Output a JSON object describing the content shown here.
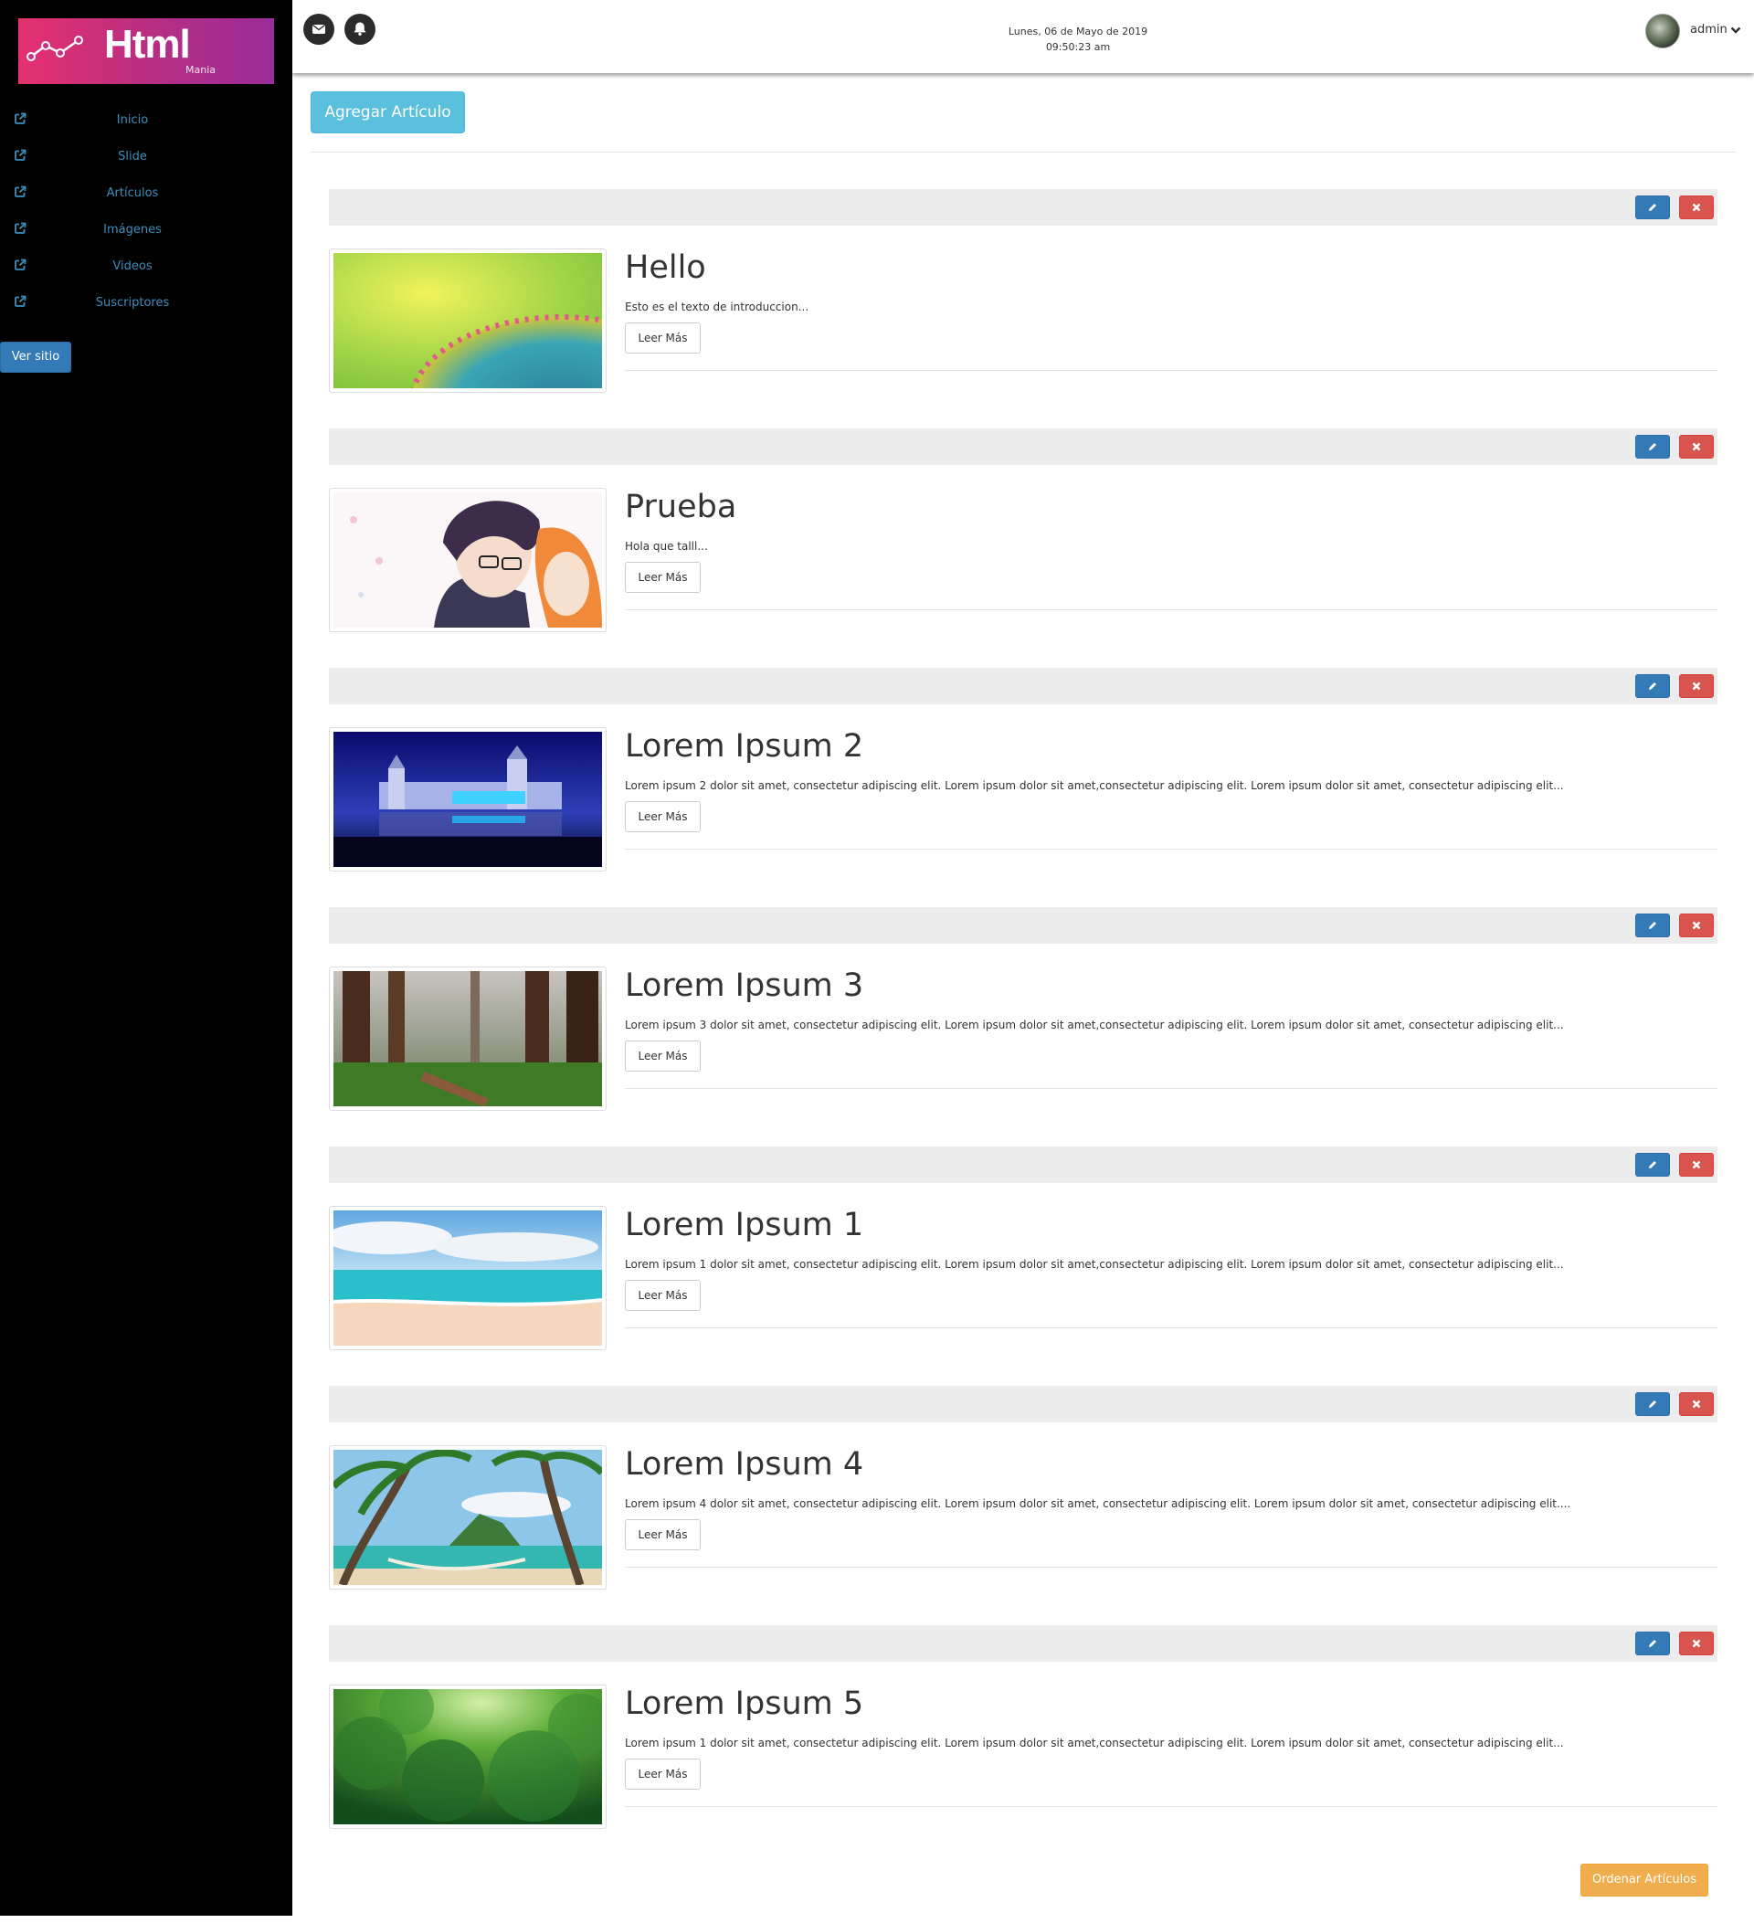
{
  "brand": {
    "name": "Html",
    "subtitle": "Mania"
  },
  "sidebar": {
    "items": [
      {
        "label": "Inicio",
        "icon": "external-link-icon"
      },
      {
        "label": "Slide",
        "icon": "external-link-icon"
      },
      {
        "label": "Artículos",
        "icon": "external-link-icon"
      },
      {
        "label": "Imágenes",
        "icon": "external-link-icon"
      },
      {
        "label": "Videos",
        "icon": "external-link-icon"
      },
      {
        "label": "Suscriptores",
        "icon": "external-link-icon"
      }
    ],
    "ver_sitio": "Ver sitio"
  },
  "header": {
    "date": "Lunes, 06 de Mayo de 2019",
    "time": "09:50:23 am",
    "user": "admin",
    "icons": [
      "envelope-icon",
      "bell-icon",
      "chevron-down-icon"
    ]
  },
  "main": {
    "add_button": "Agregar Artículo",
    "read_more": "Leer Más",
    "order_button": "Ordenar Artículos",
    "articles": [
      {
        "title": "Hello",
        "intro": "Esto es el texto de introduccion...",
        "image": "chameleon-closeup"
      },
      {
        "title": "Prueba",
        "intro": "Hola que talll...",
        "image": "anime-couple"
      },
      {
        "title": "Lorem Ipsum 2",
        "intro": "Lorem ipsum 2 dolor sit amet, consectetur adipiscing elit. Lorem ipsum dolor sit amet,consectetur adipiscing elit. Lorem ipsum dolor sit amet, consectetur adipiscing elit...",
        "image": "castle-night"
      },
      {
        "title": "Lorem Ipsum 3",
        "intro": "Lorem ipsum 3 dolor sit amet, consectetur adipiscing elit. Lorem ipsum dolor sit amet,consectetur adipiscing elit. Lorem ipsum dolor sit amet, consectetur adipiscing elit...",
        "image": "redwood-forest"
      },
      {
        "title": "Lorem Ipsum 1",
        "intro": "Lorem ipsum 1 dolor sit amet, consectetur adipiscing elit. Lorem ipsum dolor sit amet,consectetur adipiscing elit. Lorem ipsum dolor sit amet, consectetur adipiscing elit...",
        "image": "tropical-beach"
      },
      {
        "title": "Lorem Ipsum 4",
        "intro": "Lorem ipsum 4 dolor sit amet, consectetur adipiscing elit. Lorem ipsum dolor sit amet, consectetur adipiscing elit. Lorem ipsum dolor sit amet, consectetur adipiscing elit....",
        "image": "palm-hammock"
      },
      {
        "title": "Lorem Ipsum 5",
        "intro": "Lorem ipsum 1 dolor sit amet, consectetur adipiscing elit. Lorem ipsum dolor sit amet,consectetur adipiscing elit. Lorem ipsum dolor sit amet, consectetur adipiscing elit...",
        "image": "green-canopy"
      }
    ]
  },
  "colors": {
    "primary": "#337ab7",
    "danger": "#d9534f",
    "info": "#5bc0de",
    "warning": "#f0ad4e",
    "sidebar_link": "#3c8dbc",
    "sidebar_bg": "#000000"
  }
}
